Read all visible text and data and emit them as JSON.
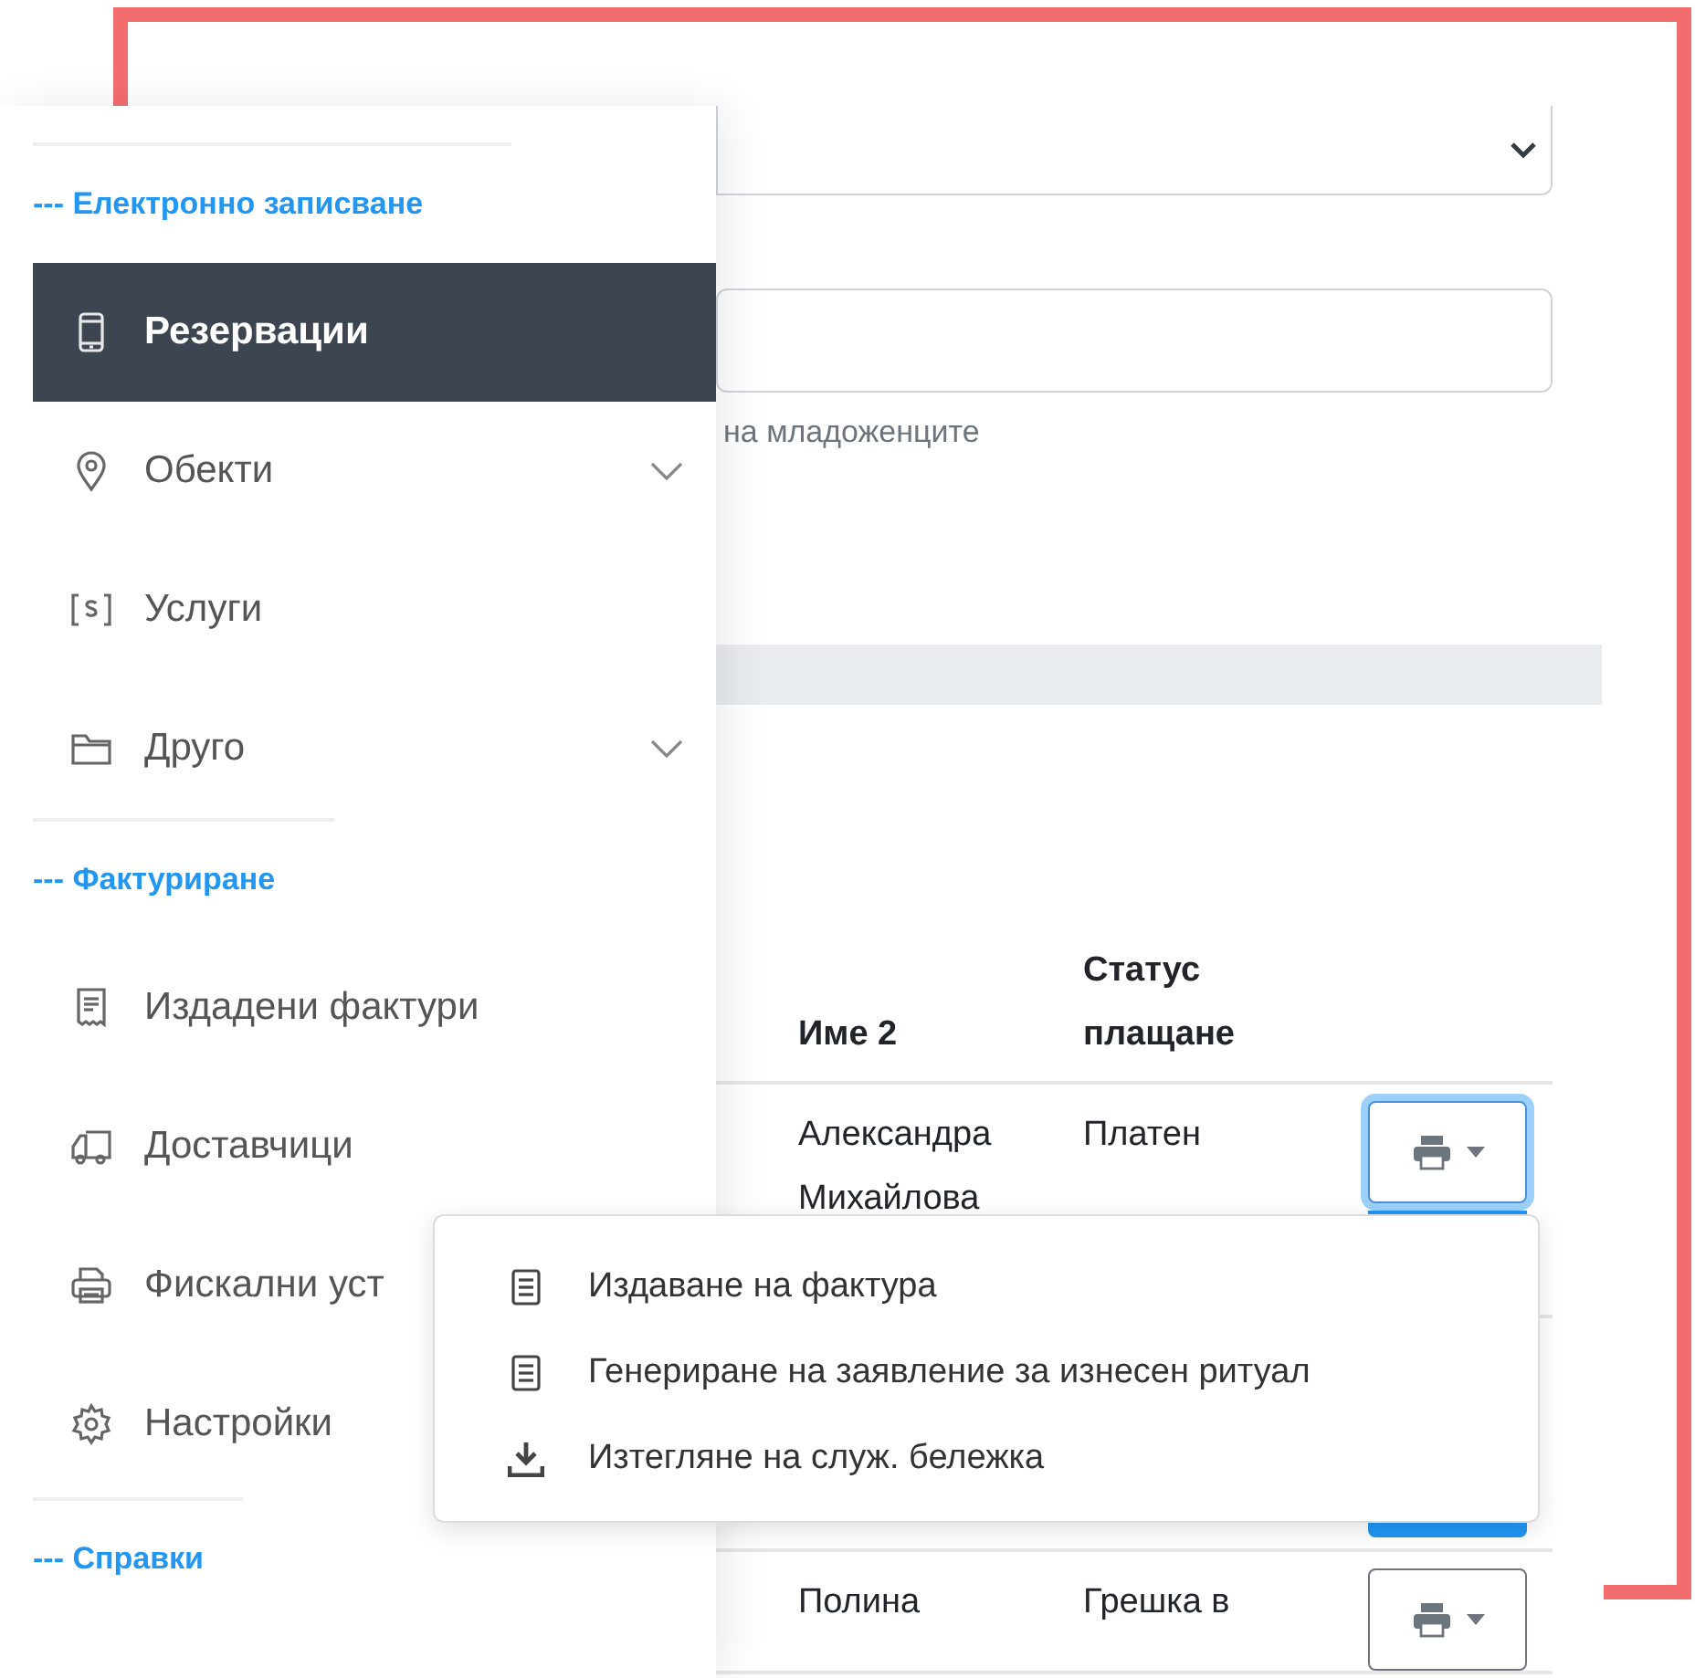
{
  "sidebar": {
    "sections": [
      {
        "title": "--- Електронно записване",
        "items": [
          {
            "label": "Резервации",
            "kind": "link",
            "selected": true
          },
          {
            "label": "Обекти",
            "kind": "group",
            "selected": false
          },
          {
            "label": "Услуги",
            "kind": "link",
            "selected": false
          },
          {
            "label": "Друго",
            "kind": "group",
            "selected": false
          }
        ]
      },
      {
        "title": "--- Фактуриране",
        "items": [
          {
            "label": "Издадени фактури",
            "kind": "link",
            "selected": false
          },
          {
            "label": "Доставчици",
            "kind": "link",
            "selected": false
          },
          {
            "label": "Фискални уст",
            "kind": "link",
            "selected": false
          },
          {
            "label": "Настройки",
            "kind": "link",
            "selected": false
          }
        ]
      },
      {
        "title": "--- Справки"
      }
    ]
  },
  "form": {
    "hint": "на младоженците"
  },
  "table": {
    "columns": [
      "Име 2",
      "Статус плащане"
    ],
    "rows": [
      {
        "cells": [
          "Александра Михайлова",
          "Платен"
        ],
        "focused": true
      },
      {
        "cells": [
          "Полина",
          "Грешка в"
        ],
        "focused": false
      }
    ]
  },
  "menu": {
    "items": [
      {
        "label": "Издаване на фактура",
        "kind": "document"
      },
      {
        "label": "Генериране на заявление за изнесен ритуал",
        "kind": "document"
      },
      {
        "label": "Изтегляне на служ. бележка",
        "kind": "download"
      }
    ]
  }
}
